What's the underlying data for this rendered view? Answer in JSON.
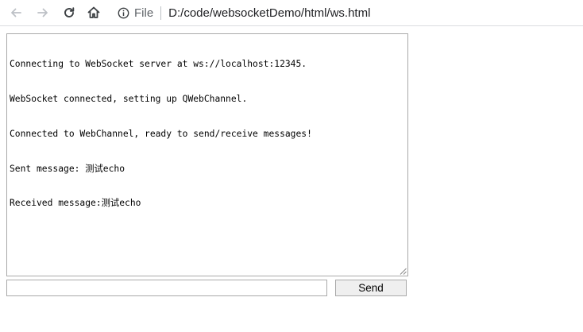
{
  "browser": {
    "scheme_label": "File",
    "url": "D:/code/websocketDemo/html/ws.html",
    "icons": {
      "back": "back-arrow-icon",
      "forward": "forward-arrow-icon",
      "reload": "reload-icon",
      "home": "home-icon",
      "site_info": "info-icon"
    }
  },
  "log": {
    "lines": [
      "Connecting to WebSocket server at ws://localhost:12345.",
      "WebSocket connected, setting up QWebChannel.",
      "Connected to WebChannel, ready to send/receive messages!",
      "Sent message: 测试echo",
      "Received message:测试echo"
    ]
  },
  "composer": {
    "input_value": "",
    "send_label": "Send"
  }
}
